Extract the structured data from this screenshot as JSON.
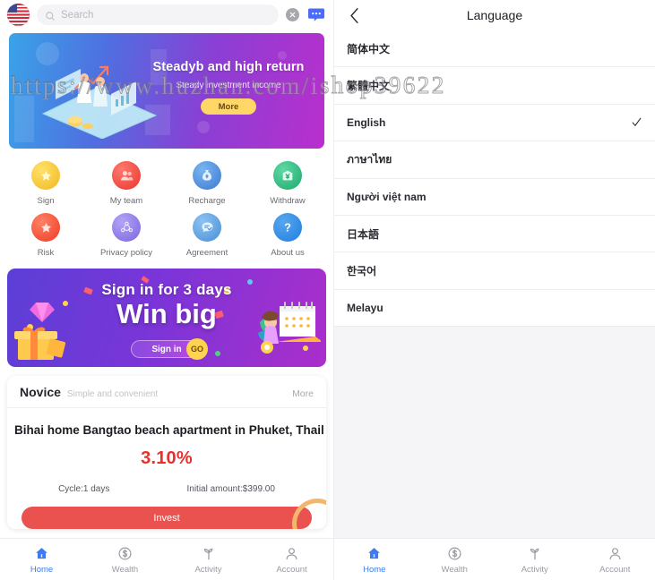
{
  "left": {
    "search": {
      "placeholder": "Search",
      "value": "",
      "search_icon": "search-icon",
      "clear_icon": "clear-circle-icon",
      "chat_icon": "chat-bubble-icon",
      "avatar_icon": "us-flag-avatar"
    },
    "hero": {
      "title": "Steadyb and high return",
      "subtitle": "Steady investment income",
      "more_label": "More",
      "gradient_from": "#3aa3e8",
      "gradient_to": "#b92fcd",
      "more_bg": "#ffd766"
    },
    "menu": [
      {
        "label": "Sign",
        "icon": "star-badge-icon",
        "color": "#f6c945"
      },
      {
        "label": "My team",
        "icon": "people-icon",
        "color": "#f0453f"
      },
      {
        "label": "Recharge",
        "icon": "money-bag-icon",
        "color": "#4f8fe0"
      },
      {
        "label": "Withdraw",
        "icon": "yen-wallet-icon",
        "color": "#2ec17f"
      },
      {
        "label": "Risk",
        "icon": "star-shield-icon",
        "color": "#f04a3a"
      },
      {
        "label": "Privacy policy",
        "icon": "privacy-lock-icon",
        "color": "#8a7ce8"
      },
      {
        "label": "Agreement",
        "icon": "agreement-icon",
        "color": "#5aa0e6"
      },
      {
        "label": "About us",
        "icon": "question-icon",
        "color": "#2f8ae8"
      }
    ],
    "promo": {
      "line1": "Sign in for 3 days",
      "line2": "Win big",
      "cta_label": "Sign in",
      "go_label": "GO"
    },
    "card": {
      "group_title": "Novice",
      "group_subtitle": "Simple and convenient",
      "more_label": "More",
      "product_title": "Bihai home Bangtao beach apartment in Phuket, Thail",
      "rate": "3.10%",
      "rate_color": "#e8312f",
      "cycle": "Cycle:1 days",
      "initial_amount": "Initial amount:$399.00",
      "invest_label": "Invest",
      "invest_color": "#e9524f"
    },
    "bottom_nav": [
      {
        "label": "Home",
        "icon": "home-icon",
        "active": true
      },
      {
        "label": "Wealth",
        "icon": "dollar-icon",
        "active": false
      },
      {
        "label": "Activity",
        "icon": "sprout-icon",
        "active": false
      },
      {
        "label": "Account",
        "icon": "person-icon",
        "active": false
      }
    ],
    "active_color": "#3d7bf0"
  },
  "right": {
    "header": {
      "title": "Language",
      "back_icon": "chevron-left-icon"
    },
    "languages": [
      {
        "name": "简体中文",
        "selected": false
      },
      {
        "name": "繁體中文",
        "selected": false
      },
      {
        "name": "English",
        "selected": true
      },
      {
        "name": "ภาษาไทย",
        "selected": false
      },
      {
        "name": "Người việt nam",
        "selected": false
      },
      {
        "name": "日本語",
        "selected": false
      },
      {
        "name": "한국어",
        "selected": false
      },
      {
        "name": "Melayu",
        "selected": false
      }
    ],
    "check_icon": "checkmark-icon",
    "bottom_nav": [
      {
        "label": "Home",
        "icon": "home-icon",
        "active": true
      },
      {
        "label": "Wealth",
        "icon": "dollar-icon",
        "active": false
      },
      {
        "label": "Activity",
        "icon": "sprout-icon",
        "active": false
      },
      {
        "label": "Account",
        "icon": "person-icon",
        "active": false
      }
    ]
  },
  "watermark": {
    "text": "https://www.huzhan.com/ishop39622"
  }
}
